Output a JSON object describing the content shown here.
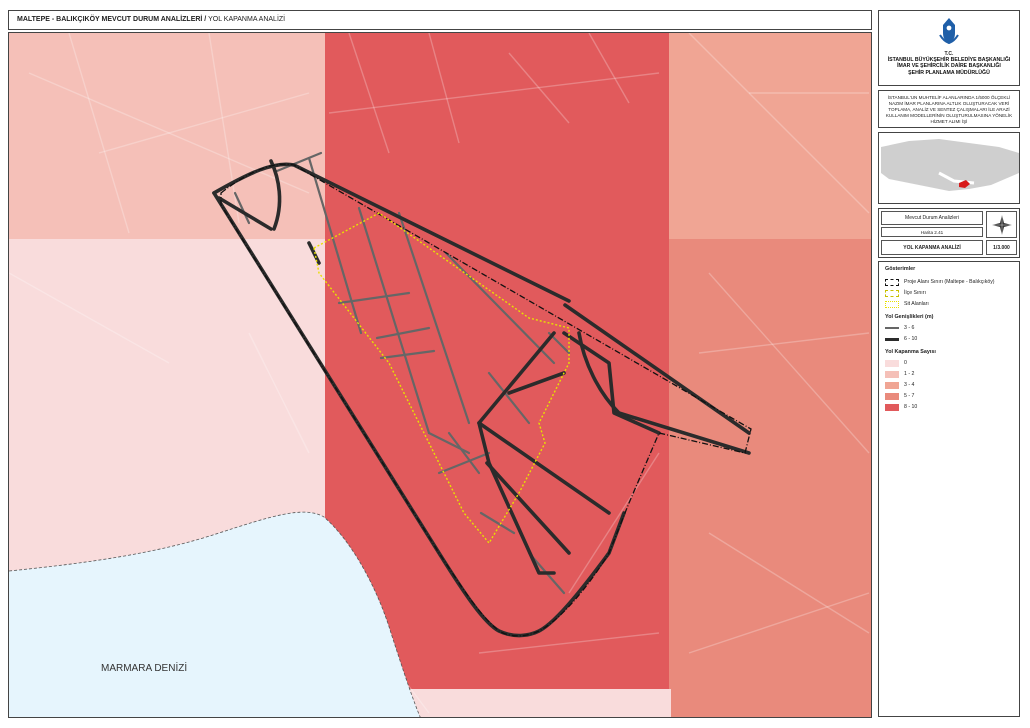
{
  "title": {
    "main": "MALTEPE - BALIKÇIKÖY MEVCUT DURUM ANALİZLERİ /",
    "sub": " YOL KAPANMA ANALİZİ"
  },
  "org": {
    "tc": "T.C.",
    "line1": "İSTANBUL BÜYÜKŞEHİR BELEDİYE BAŞKANLIĞI",
    "line2": "İMAR VE ŞEHİRCİLİK DAİRE BAŞKANLIĞI",
    "line3": "ŞEHİR PLANLAMA MÜDÜRLÜĞÜ"
  },
  "description": "İSTANBUL'UN MUHTELİF ALANLARINDA 1/5000 ÖLÇEKLİ NAZIM İMAR PLANLARINA ALTLIK OLUŞTURACAK VERİ TOPLAMA, ANALİZ VE SENTEZ ÇALIŞMALARI İLE ARAZİ KULLANIM MODELLERİNİN OLUŞTURULMASINA YÖNELİK HİZMET ALIMI İŞİ",
  "info": {
    "analysis": "Mevcut Durum Analizleri",
    "map_no": "Harita 2.41",
    "map_title": "YOL KAPANMA ANALİZİ",
    "scale": "1/3.000"
  },
  "map": {
    "sea_label": "MARMARA DENİZİ"
  },
  "legend": {
    "title": "Gösterimler",
    "boundary": "Proje Alanı Sınırı (Maltepe - Balıkçıköy)",
    "district": "İlçe Sınırı",
    "sit": "Sit Alanları",
    "road_width_title": "Yol Genişlikleri (m)",
    "road_widths": [
      {
        "label": "3 - 6"
      },
      {
        "label": "6 - 10"
      }
    ],
    "closure_title": "Yol Kapanma Sayısı",
    "closure_classes": [
      {
        "label": "0",
        "color": "#f9dcdc"
      },
      {
        "label": "1 - 2",
        "color": "#f5c0b8"
      },
      {
        "label": "3 - 4",
        "color": "#f0a594"
      },
      {
        "label": "5 - 7",
        "color": "#e98a7c"
      },
      {
        "label": "8 - 10",
        "color": "#e15a5c"
      }
    ]
  },
  "colors": {
    "sea": "#e6f5fd",
    "road_thin": "#666666",
    "road_thick": "#2b2b2b",
    "sit": "#e8e000",
    "logo": "#1f5fa8",
    "highlight": "#d81b1b"
  }
}
